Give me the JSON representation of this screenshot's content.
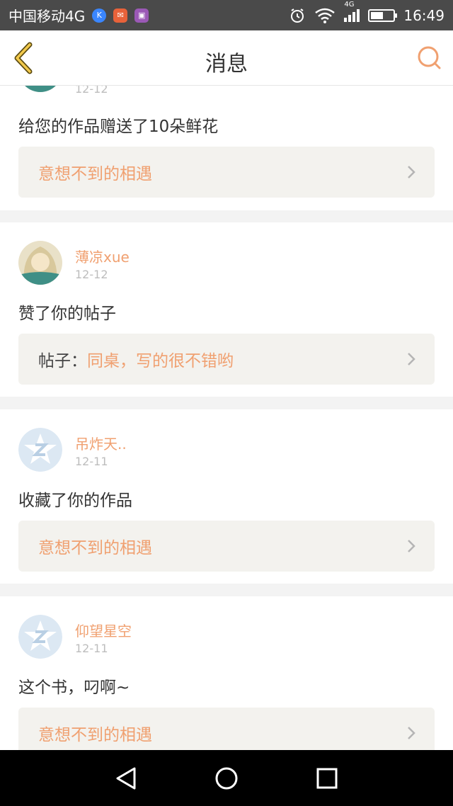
{
  "status_bar": {
    "carrier": "中国移动4G",
    "network": "4G",
    "time": "16:49",
    "battery_level": 0.55
  },
  "header": {
    "title": "消息"
  },
  "items": [
    {
      "date": "12-12",
      "message": "给您的作品赠送了10朵鲜花",
      "link_prefix": "",
      "link_text": "意想不到的相遇"
    },
    {
      "username": "薄凉xue",
      "date": "12-12",
      "message": "赞了你的帖子",
      "link_prefix": "帖子：",
      "link_text": "同桌，写的很不错哟"
    },
    {
      "username": "吊炸天..",
      "date": "12-11",
      "message": "收藏了你的作品",
      "link_prefix": "",
      "link_text": "意想不到的相遇"
    },
    {
      "username": "仰望星空",
      "date": "12-11",
      "message": "这个书，叼啊~",
      "link_prefix": "",
      "link_text": "意想不到的相遇"
    }
  ],
  "colors": {
    "accent": "#f0a070",
    "status_bar": "#4a4a4a",
    "link_box_bg": "#f3f2ee",
    "separator": "#f3f3f3"
  }
}
